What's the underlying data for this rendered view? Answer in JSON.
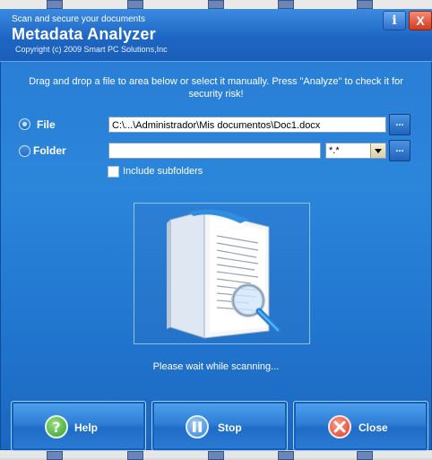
{
  "header": {
    "tagline": "Scan and secure your documents",
    "title": "Metadata Analyzer",
    "copyright": "Copyright (c) 2009 Smart PC Solutions,Inc",
    "info_icon": "info-icon",
    "close_icon": "close-icon",
    "info_symbol": "i",
    "close_symbol": "X"
  },
  "instructions": "Drag and drop a file to area below or select it manually. Press \"Analyze\" to check it for security risk!",
  "file": {
    "label": "File",
    "value": "C:\\...\\Administrador\\Mis documentos\\Doc1.docx",
    "browse_label": "...",
    "selected": true
  },
  "folder": {
    "label": "Folder",
    "value": "",
    "filter_value": "*.*",
    "browse_label": "...",
    "selected": false
  },
  "subfolders": {
    "label": "Include subfolders",
    "checked": false
  },
  "drop_area": {
    "icon": "document-magnifier-icon"
  },
  "status": "Please wait while scanning...",
  "buttons": {
    "help": {
      "label": "Help",
      "icon": "question-icon",
      "color": "#2f9b33"
    },
    "stop": {
      "label": "Stop",
      "icon": "pause-icon",
      "color": "#2b7cd4"
    },
    "close": {
      "label": "Close",
      "icon": "x-circle-icon",
      "color": "#d83a2a"
    }
  },
  "colors": {
    "window_blue": "#2a7fd6",
    "accent": "#1e66c3"
  }
}
